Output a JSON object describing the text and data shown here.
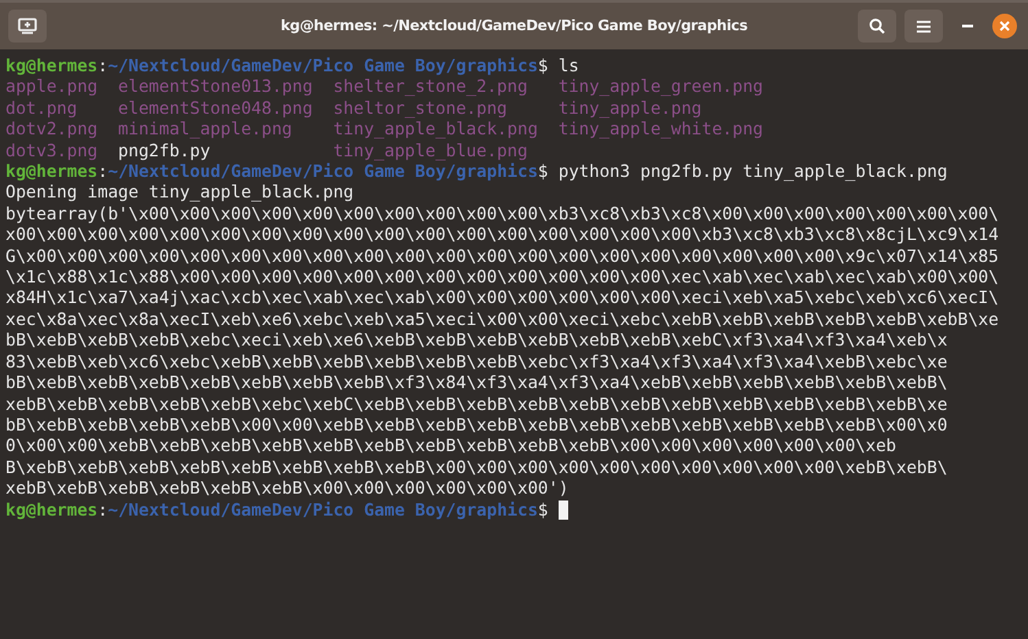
{
  "window": {
    "title": "kg@hermes: ~/Nextcloud/GameDev/Pico Game Boy/graphics"
  },
  "terminal": {
    "lines": [
      {
        "kind": "prompt",
        "user": "kg@hermes",
        "separator": ":",
        "path": "~/Nextcloud/GameDev/Pico Game Boy/graphics",
        "symbol": "$",
        "command": "ls",
        "cursor": false
      },
      {
        "kind": "listing",
        "rows": [
          [
            {
              "name": "apple.png",
              "color": "#8c4f89"
            },
            {
              "name": "elementStone013.png",
              "color": "#8c4f89"
            },
            {
              "name": "shelter_stone_2.png",
              "color": "#8c4f89"
            },
            {
              "name": "tiny_apple_green.png",
              "color": "#8c4f89"
            }
          ],
          [
            {
              "name": "dot.png",
              "color": "#8c4f89"
            },
            {
              "name": "elementStone048.png",
              "color": "#8c4f89"
            },
            {
              "name": "sheltor_stone.png",
              "color": "#8c4f89"
            },
            {
              "name": "tiny_apple.png",
              "color": "#8c4f89"
            }
          ],
          [
            {
              "name": "dotv2.png",
              "color": "#8c4f89"
            },
            {
              "name": "minimal_apple.png",
              "color": "#8c4f89"
            },
            {
              "name": "tiny_apple_black.png",
              "color": "#8c4f89"
            },
            {
              "name": "tiny_apple_white.png",
              "color": "#8c4f89"
            }
          ],
          [
            {
              "name": "dotv3.png",
              "color": "#8c4f89"
            },
            {
              "name": "png2fb.py",
              "color": "#e6e6e6"
            },
            {
              "name": "tiny_apple_blue.png",
              "color": "#8c4f89"
            }
          ]
        ]
      },
      {
        "kind": "prompt",
        "user": "kg@hermes",
        "separator": ":",
        "path": "~/Nextcloud/GameDev/Pico Game Boy/graphics",
        "symbol": "$",
        "command": "python3 png2fb.py tiny_apple_black.png",
        "cursor": false
      },
      {
        "kind": "text",
        "text": "Opening image tiny_apple_black.png"
      },
      {
        "kind": "text",
        "text": "bytearray(b'\\x00\\x00\\x00\\x00\\x00\\x00\\x00\\x00\\x00\\x00\\xb3\\xc8\\xb3\\xc8\\x00\\x00\\x00\\x00\\x00\\x00\\x00\\"
      },
      {
        "kind": "text",
        "text": "x00\\x00\\x00\\x00\\x00\\x00\\x00\\x00\\x00\\x00\\x00\\x00\\x00\\x00\\x00\\x00\\x00\\xb3\\xc8\\xb3\\xc8\\x8cjL\\xc9\\x14"
      },
      {
        "kind": "text",
        "text": "G\\x00\\x00\\x00\\x00\\x00\\x00\\x00\\x00\\x00\\x00\\x00\\x00\\x00\\x00\\x00\\x00\\x00\\x00\\x00\\x00\\x9c\\x07\\x14\\x85"
      },
      {
        "kind": "text",
        "text": "\\x1c\\x88\\x1c\\x88\\x00\\x00\\x00\\x00\\x00\\x00\\x00\\x00\\x00\\x00\\x00\\x00\\xec\\xab\\xec\\xab\\xec\\xab\\x00\\x00\\"
      },
      {
        "kind": "text",
        "text": "x84H\\x1c\\xa7\\xa4j\\xac\\xcb\\xec\\xab\\xec\\xab\\x00\\x00\\x00\\x00\\x00\\x00\\xeci\\xeb\\xa5\\xebc\\xeb\\xc6\\xecI\\"
      },
      {
        "kind": "text",
        "text": "xec\\x8a\\xec\\x8a\\xecI\\xeb\\xe6\\xebc\\xeb\\xa5\\xeci\\x00\\x00\\xeci\\xebc\\xebB\\xebB\\xebB\\xebB\\xebB\\xebB\\xe"
      },
      {
        "kind": "text",
        "text": "bB\\xebB\\xebB\\xebB\\xebc\\xeci\\xeb\\xe6\\xebB\\xebB\\xebB\\xebB\\xebB\\xebB\\xebC\\xf3\\xa4\\xf3\\xa4\\xeb\\x"
      },
      {
        "kind": "text",
        "text": "83\\xebB\\xeb\\xc6\\xebc\\xebB\\xebB\\xebB\\xebB\\xebB\\xebB\\xebc\\xf3\\xa4\\xf3\\xa4\\xf3\\xa4\\xebB\\xebc\\xe"
      },
      {
        "kind": "text",
        "text": "bB\\xebB\\xebB\\xebB\\xebB\\xebB\\xebB\\xebB\\xf3\\x84\\xf3\\xa4\\xf3\\xa4\\xebB\\xebB\\xebB\\xebB\\xebB\\xebB\\"
      },
      {
        "kind": "text",
        "text": "xebB\\xebB\\xebB\\xebB\\xebB\\xebc\\xebC\\xebB\\xebB\\xebB\\xebB\\xebB\\xebB\\xebB\\xebB\\xebB\\xebB\\xebB\\xe"
      },
      {
        "kind": "text",
        "text": "bB\\xebB\\xebB\\xebB\\xebB\\x00\\x00\\xebB\\xebB\\xebB\\xebB\\xebB\\xebB\\xebB\\xebB\\xebB\\xebB\\xebB\\x00\\x0"
      },
      {
        "kind": "text",
        "text": "0\\x00\\x00\\xebB\\xebB\\xebB\\xebB\\xebB\\xebB\\xebB\\xebB\\xebB\\xebB\\x00\\x00\\x00\\x00\\x00\\x00\\xeb"
      },
      {
        "kind": "text",
        "text": "B\\xebB\\xebB\\xebB\\xebB\\xebB\\xebB\\xebB\\xebB\\x00\\x00\\x00\\x00\\x00\\x00\\x00\\x00\\x00\\x00\\xebB\\xebB\\"
      },
      {
        "kind": "text",
        "text": "xebB\\xebB\\xebB\\xebB\\xebB\\xebB\\x00\\x00\\x00\\x00\\x00\\x00')"
      },
      {
        "kind": "prompt",
        "user": "kg@hermes",
        "separator": ":",
        "path": "~/Nextcloud/GameDev/Pico Game Boy/graphics",
        "symbol": "$",
        "cursor": true
      }
    ]
  }
}
